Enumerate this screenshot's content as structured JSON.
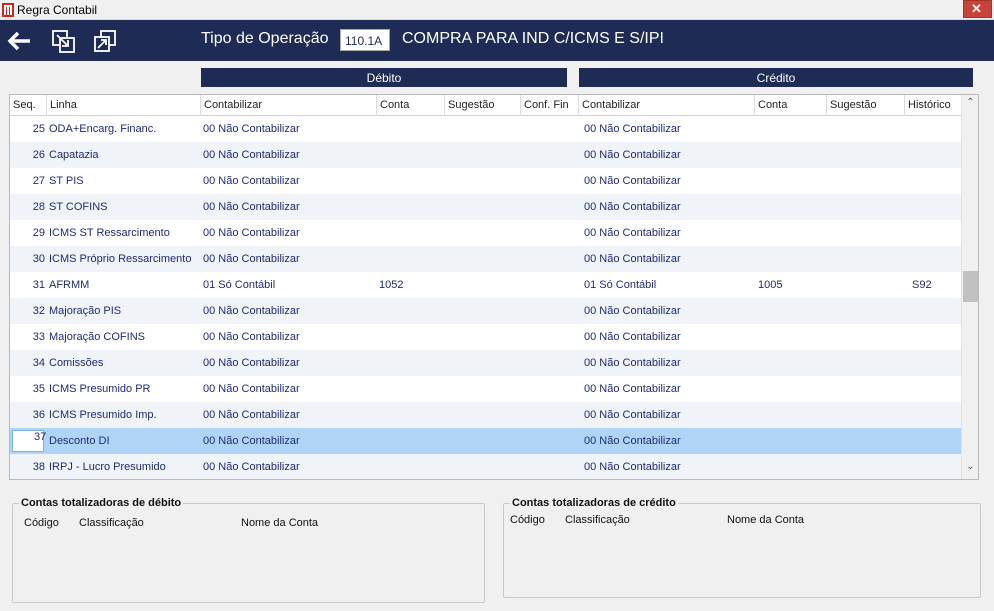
{
  "window": {
    "title": "Regra Contabil",
    "close_glyph": "✕"
  },
  "toolbar": {
    "icons": [
      "back-arrow-icon",
      "export-icon",
      "copy-icon"
    ],
    "tipo_label": "Tipo de Operação",
    "tipo_code": "110.1A",
    "tipo_desc": "COMPRA PARA IND C/ICMS E S/IPI"
  },
  "sections": {
    "debito": "Débito",
    "credito": "Crédito"
  },
  "grid": {
    "headers": {
      "seq": "Seq.",
      "linha": "Linha",
      "d_contabilizar": "Contabilizar",
      "d_conta": "Conta",
      "d_sugestao": "Sugestão",
      "d_conf_fin": "Conf. Fin",
      "c_contabilizar": "Contabilizar",
      "c_conta": "Conta",
      "c_sugestao": "Sugestão",
      "c_historico": "Histórico"
    },
    "rows": [
      {
        "seq": "25",
        "linha": "ODA+Encarg. Financ.",
        "d_contabilizar": "00 Não Contabilizar",
        "d_conta": "",
        "c_contabilizar": "00 Não Contabilizar",
        "c_conta": "",
        "c_historico": ""
      },
      {
        "seq": "26",
        "linha": "Capatazia",
        "d_contabilizar": "00 Não Contabilizar",
        "d_conta": "",
        "c_contabilizar": "00 Não Contabilizar",
        "c_conta": "",
        "c_historico": ""
      },
      {
        "seq": "27",
        "linha": "ST PIS",
        "d_contabilizar": "00 Não Contabilizar",
        "d_conta": "",
        "c_contabilizar": "00 Não Contabilizar",
        "c_conta": "",
        "c_historico": ""
      },
      {
        "seq": "28",
        "linha": "ST COFINS",
        "d_contabilizar": "00 Não Contabilizar",
        "d_conta": "",
        "c_contabilizar": "00 Não Contabilizar",
        "c_conta": "",
        "c_historico": ""
      },
      {
        "seq": "29",
        "linha": "ICMS ST Ressarcimento",
        "d_contabilizar": "00 Não Contabilizar",
        "d_conta": "",
        "c_contabilizar": "00 Não Contabilizar",
        "c_conta": "",
        "c_historico": ""
      },
      {
        "seq": "30",
        "linha": "ICMS Próprio Ressarcimento",
        "d_contabilizar": "00 Não Contabilizar",
        "d_conta": "",
        "c_contabilizar": "00 Não Contabilizar",
        "c_conta": "",
        "c_historico": ""
      },
      {
        "seq": "31",
        "linha": "AFRMM",
        "d_contabilizar": "01 Só Contábil",
        "d_conta": "1052",
        "c_contabilizar": "01 Só Contábil",
        "c_conta": "1005",
        "c_historico": "S92"
      },
      {
        "seq": "32",
        "linha": "Majoração PIS",
        "d_contabilizar": "00 Não Contabilizar",
        "d_conta": "",
        "c_contabilizar": "00 Não Contabilizar",
        "c_conta": "",
        "c_historico": ""
      },
      {
        "seq": "33",
        "linha": "Majoração COFINS",
        "d_contabilizar": "00 Não Contabilizar",
        "d_conta": "",
        "c_contabilizar": "00 Não Contabilizar",
        "c_conta": "",
        "c_historico": ""
      },
      {
        "seq": "34",
        "linha": "Comissões",
        "d_contabilizar": "00 Não Contabilizar",
        "d_conta": "",
        "c_contabilizar": "00 Não Contabilizar",
        "c_conta": "",
        "c_historico": ""
      },
      {
        "seq": "35",
        "linha": "ICMS Presumido PR",
        "d_contabilizar": "00 Não Contabilizar",
        "d_conta": "",
        "c_contabilizar": "00 Não Contabilizar",
        "c_conta": "",
        "c_historico": ""
      },
      {
        "seq": "36",
        "linha": "ICMS Presumido Imp.",
        "d_contabilizar": "00 Não Contabilizar",
        "d_conta": "",
        "c_contabilizar": "00 Não Contabilizar",
        "c_conta": "",
        "c_historico": ""
      },
      {
        "seq": "37",
        "linha": "Desconto DI",
        "d_contabilizar": "00 Não Contabilizar",
        "d_conta": "",
        "c_contabilizar": "00 Não Contabilizar",
        "c_conta": "",
        "c_historico": ""
      },
      {
        "seq": "38",
        "linha": "IRPJ - Lucro Presumido",
        "d_contabilizar": "00 Não Contabilizar",
        "d_conta": "",
        "c_contabilizar": "00 Não Contabilizar",
        "c_conta": "",
        "c_historico": ""
      }
    ]
  },
  "totals_debito": {
    "title": "Contas totalizadoras de débito",
    "col_codigo": "Código",
    "col_classificacao": "Classificação",
    "col_nome": "Nome da Conta"
  },
  "totals_credito": {
    "title": "Contas totalizadoras de crédito",
    "col_codigo": "Código",
    "col_classificacao": "Classificação",
    "col_nome": "Nome da Conta"
  },
  "colors": {
    "navy": "#1d2b55",
    "row_text": "#1d2b78",
    "selection": "#b0d4f8",
    "alt_row": "#f0f3f8"
  }
}
